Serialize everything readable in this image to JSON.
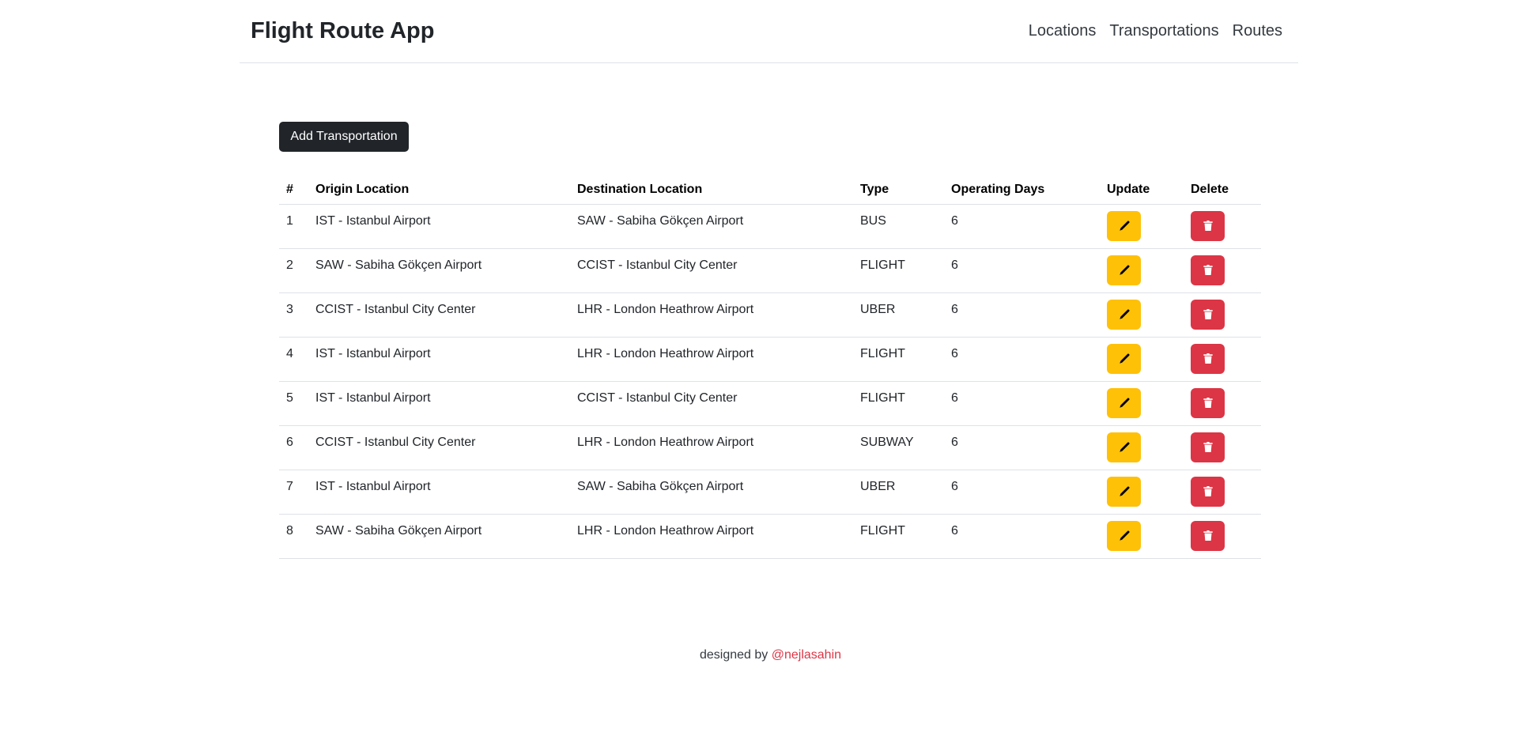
{
  "navbar": {
    "brand": "Flight Route App",
    "links": [
      "Locations",
      "Transportations",
      "Routes"
    ]
  },
  "main": {
    "add_button_label": "Add Transportation",
    "table": {
      "headers": [
        "#",
        "Origin Location",
        "Destination Location",
        "Type",
        "Operating Days",
        "Update",
        "Delete"
      ],
      "rows": [
        {
          "id": "1",
          "origin": "IST - Istanbul Airport",
          "destination": "SAW - Sabiha Gökçen Airport",
          "type": "BUS",
          "days": "6"
        },
        {
          "id": "2",
          "origin": "SAW - Sabiha Gökçen Airport",
          "destination": "CCIST - Istanbul City Center",
          "type": "FLIGHT",
          "days": "6"
        },
        {
          "id": "3",
          "origin": "CCIST - Istanbul City Center",
          "destination": "LHR - London Heathrow Airport",
          "type": "UBER",
          "days": "6"
        },
        {
          "id": "4",
          "origin": "IST - Istanbul Airport",
          "destination": "LHR - London Heathrow Airport",
          "type": "FLIGHT",
          "days": "6"
        },
        {
          "id": "5",
          "origin": "IST - Istanbul Airport",
          "destination": "CCIST - Istanbul City Center",
          "type": "FLIGHT",
          "days": "6"
        },
        {
          "id": "6",
          "origin": "CCIST - Istanbul City Center",
          "destination": "LHR - London Heathrow Airport",
          "type": "SUBWAY",
          "days": "6"
        },
        {
          "id": "7",
          "origin": "IST - Istanbul Airport",
          "destination": "SAW - Sabiha Gökçen Airport",
          "type": "UBER",
          "days": "6"
        },
        {
          "id": "8",
          "origin": "SAW - Sabiha Gökçen Airport",
          "destination": "LHR - London Heathrow Airport",
          "type": "FLIGHT",
          "days": "6"
        }
      ]
    },
    "icons": {
      "update": "pencil-icon",
      "delete": "trash-icon"
    }
  },
  "footer": {
    "prefix": "designed by",
    "author": "@nejlasahin"
  },
  "colors": {
    "primary_dark": "#212529",
    "warning": "#ffc107",
    "danger": "#dc3545"
  }
}
